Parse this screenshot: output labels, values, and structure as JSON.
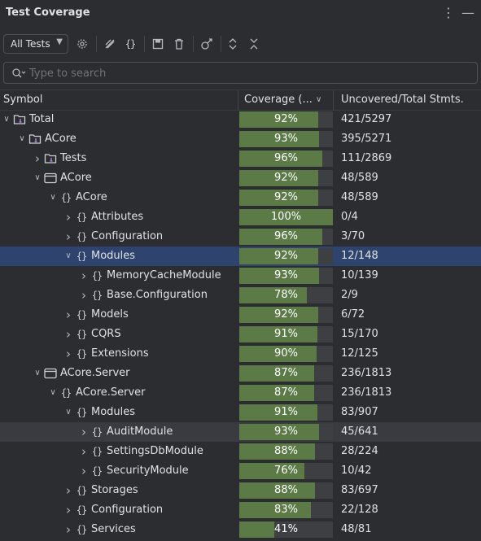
{
  "panel": {
    "title": "Test Coverage",
    "more_icon": "more-vertical-icon",
    "minimize_icon": "minimize-icon"
  },
  "toolbar": {
    "filter_value": "All Tests",
    "buttons": [
      "settings-icon",
      "flatten-icon",
      "namespace-braces-icon",
      "save-icon",
      "delete-icon",
      "run-with-coverage-icon",
      "expand-all-icon",
      "collapse-all-icon"
    ]
  },
  "search": {
    "placeholder": "Type to search",
    "value": ""
  },
  "columns": {
    "symbol": "Symbol",
    "coverage": "Coverage (...",
    "stmts": "Uncovered/Total Stmts."
  },
  "rows": [
    {
      "label": "Total",
      "icon": "folder-test",
      "depth": 0,
      "expanded": true,
      "coverage": 92,
      "pct": "92%",
      "stmts": "421/5297"
    },
    {
      "label": "ACore",
      "icon": "folder-test",
      "depth": 1,
      "expanded": true,
      "coverage": 93,
      "pct": "93%",
      "stmts": "395/5271"
    },
    {
      "label": "Tests",
      "icon": "folder-test",
      "depth": 2,
      "expanded": false,
      "coverage": 96,
      "pct": "96%",
      "stmts": "111/2869"
    },
    {
      "label": "ACore",
      "icon": "project",
      "depth": 2,
      "expanded": true,
      "coverage": 92,
      "pct": "92%",
      "stmts": "48/589"
    },
    {
      "label": "ACore",
      "icon": "namespace",
      "depth": 3,
      "expanded": true,
      "coverage": 92,
      "pct": "92%",
      "stmts": "48/589"
    },
    {
      "label": "Attributes",
      "icon": "namespace",
      "depth": 4,
      "expanded": false,
      "coverage": 100,
      "pct": "100%",
      "stmts": "0/4"
    },
    {
      "label": "Configuration",
      "icon": "namespace",
      "depth": 4,
      "expanded": false,
      "coverage": 96,
      "pct": "96%",
      "stmts": "3/70"
    },
    {
      "label": "Modules",
      "icon": "namespace",
      "depth": 4,
      "expanded": true,
      "coverage": 92,
      "pct": "92%",
      "stmts": "12/148",
      "state": "selected"
    },
    {
      "label": "MemoryCacheModule",
      "icon": "namespace",
      "depth": 5,
      "expanded": false,
      "coverage": 93,
      "pct": "93%",
      "stmts": "10/139"
    },
    {
      "label": "Base.Configuration",
      "icon": "namespace",
      "depth": 5,
      "expanded": false,
      "coverage": 78,
      "pct": "78%",
      "stmts": "2/9"
    },
    {
      "label": "Models",
      "icon": "namespace",
      "depth": 4,
      "expanded": false,
      "coverage": 92,
      "pct": "92%",
      "stmts": "6/72"
    },
    {
      "label": "CQRS",
      "icon": "namespace",
      "depth": 4,
      "expanded": false,
      "coverage": 91,
      "pct": "91%",
      "stmts": "15/170"
    },
    {
      "label": "Extensions",
      "icon": "namespace",
      "depth": 4,
      "expanded": false,
      "coverage": 90,
      "pct": "90%",
      "stmts": "12/125"
    },
    {
      "label": "ACore.Server",
      "icon": "project",
      "depth": 2,
      "expanded": true,
      "coverage": 87,
      "pct": "87%",
      "stmts": "236/1813"
    },
    {
      "label": "ACore.Server",
      "icon": "namespace",
      "depth": 3,
      "expanded": true,
      "coverage": 87,
      "pct": "87%",
      "stmts": "236/1813"
    },
    {
      "label": "Modules",
      "icon": "namespace",
      "depth": 4,
      "expanded": true,
      "coverage": 91,
      "pct": "91%",
      "stmts": "83/907"
    },
    {
      "label": "AuditModule",
      "icon": "namespace",
      "depth": 5,
      "expanded": false,
      "coverage": 93,
      "pct": "93%",
      "stmts": "45/641",
      "state": "hovered"
    },
    {
      "label": "SettingsDbModule",
      "icon": "namespace",
      "depth": 5,
      "expanded": false,
      "coverage": 88,
      "pct": "88%",
      "stmts": "28/224"
    },
    {
      "label": "SecurityModule",
      "icon": "namespace",
      "depth": 5,
      "expanded": false,
      "coverage": 76,
      "pct": "76%",
      "stmts": "10/42"
    },
    {
      "label": "Storages",
      "icon": "namespace",
      "depth": 4,
      "expanded": false,
      "coverage": 88,
      "pct": "88%",
      "stmts": "83/697"
    },
    {
      "label": "Configuration",
      "icon": "namespace",
      "depth": 4,
      "expanded": false,
      "coverage": 83,
      "pct": "83%",
      "stmts": "22/128"
    },
    {
      "label": "Services",
      "icon": "namespace",
      "depth": 4,
      "expanded": false,
      "coverage": 41,
      "pct": "41%",
      "stmts": "48/81"
    }
  ],
  "colors": {
    "covered": "#5b7a45",
    "uncovered": "#3d3f43",
    "selected": "#2e436e",
    "hovered": "#393b40"
  }
}
